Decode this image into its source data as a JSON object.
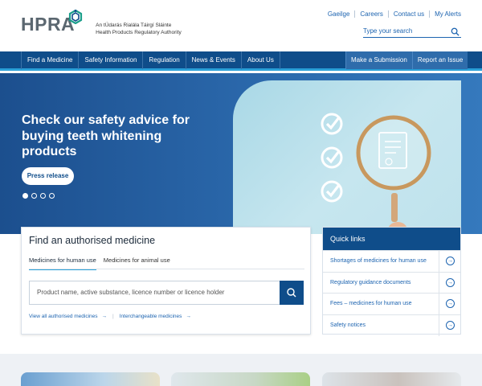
{
  "header": {
    "logo_word": "HPRA",
    "logo_line1": "An tÚdarás Rialála Táirgí Sláinte",
    "logo_line2": "Health Products Regulatory Authority",
    "util_links": [
      "Gaeilge",
      "Careers",
      "Contact us",
      "My Alerts"
    ],
    "search_placeholder": "Type your search"
  },
  "nav": {
    "items": [
      "Find a Medicine",
      "Safety Information",
      "Regulation",
      "News & Events",
      "About Us"
    ],
    "cta": [
      "Make a Submission",
      "Report an Issue"
    ]
  },
  "hero": {
    "title": "Check our safety advice for buying teeth whitening products",
    "button": "Press release",
    "slide_count": 4,
    "active_slide": 1
  },
  "find": {
    "title": "Find an authorised medicine",
    "tabs": [
      "Medicines for human use",
      "Medicines for animal use"
    ],
    "active_tab": 0,
    "input_placeholder": "Product name, active substance, licence number or licence holder",
    "links": [
      "View all authorised medicines",
      "Interchangeable medicines"
    ]
  },
  "quick_links": {
    "title": "Quick links",
    "items": [
      "Shortages of medicines for human use",
      "Regulatory guidance documents",
      "Fees – medicines for human use",
      "Safety notices"
    ]
  },
  "colors": {
    "navy": "#0f4d8a",
    "accent": "#2aa0d8",
    "link": "#1d64b0"
  },
  "icons": {
    "search": "search-icon",
    "arrow": "arrow-right-icon",
    "check": "check-circle-icon",
    "magnifier": "magnifying-glass-icon"
  }
}
